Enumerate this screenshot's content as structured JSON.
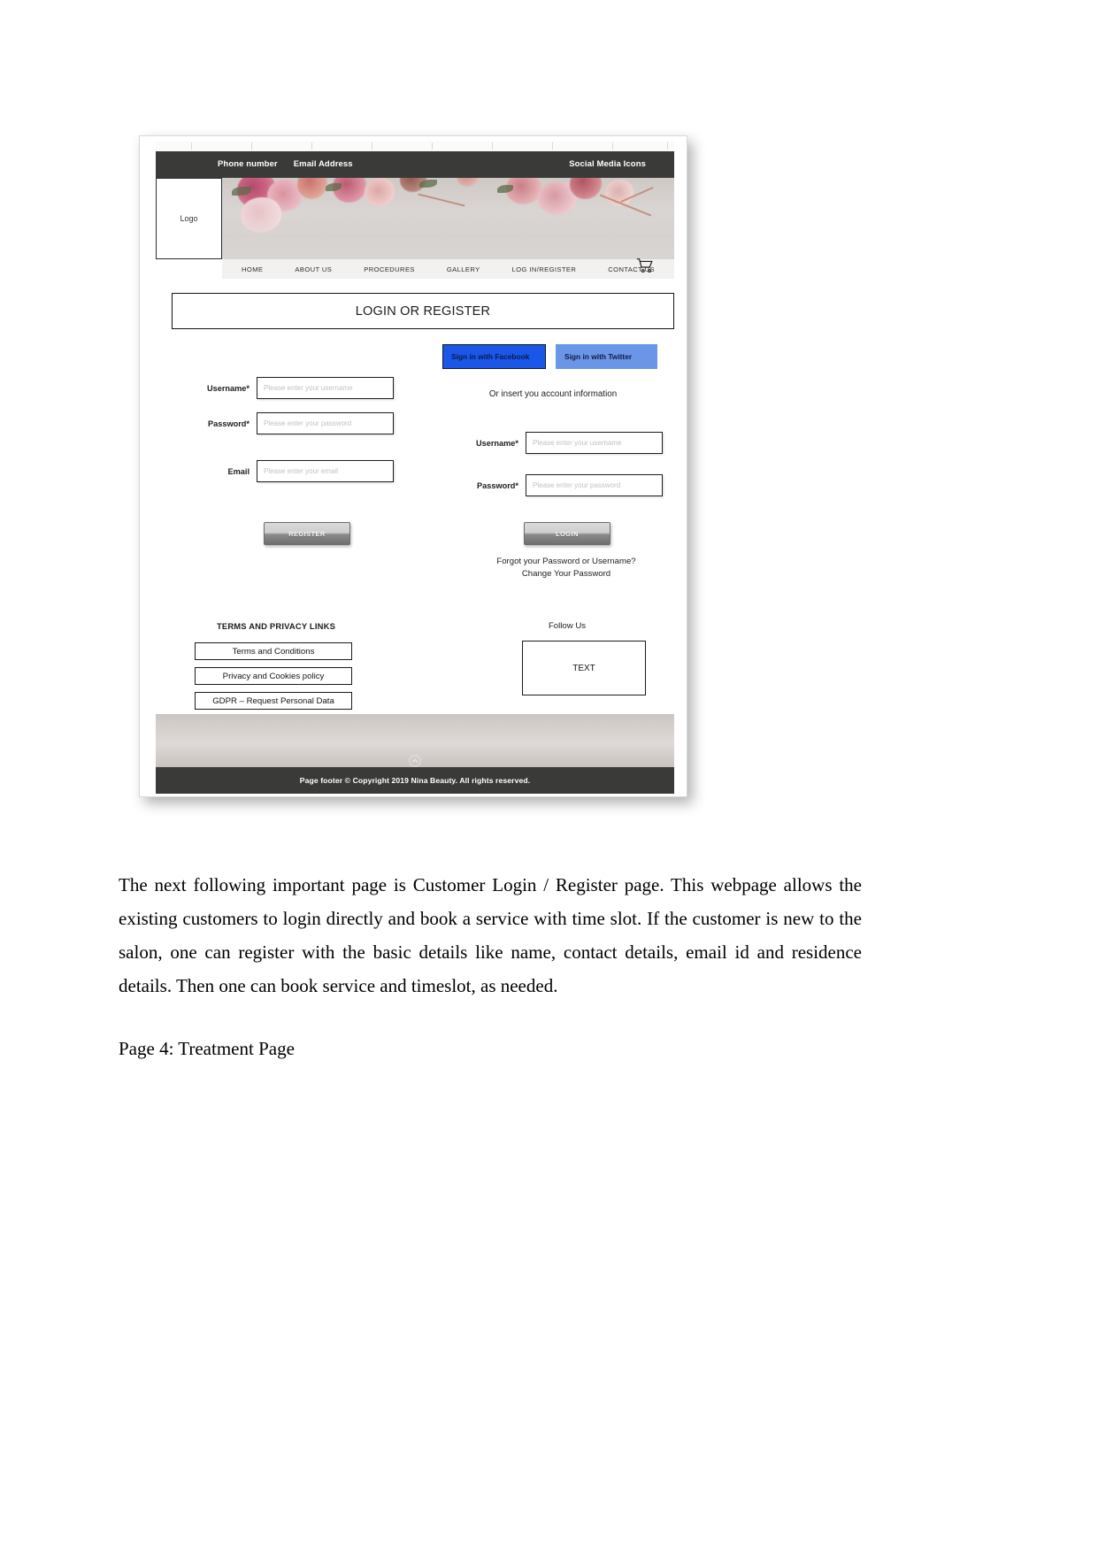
{
  "document": {
    "paragraph": "The next following important page is Customer Login / Register page. This webpage allows the existing customers to login directly and book a service with time slot. If the customer is new to the salon, one can register with the basic details like name, contact details, email id and residence details. Then one can book service and timeslot, as needed.",
    "subheading": "Page 4: Treatment Page"
  },
  "mockup": {
    "topbar": {
      "phone_label": "Phone number",
      "email_label": "Email Address",
      "social_label": "Social Media Icons"
    },
    "logo": "Logo",
    "nav": [
      "HOME",
      "ABOUT US",
      "PROCEDURES",
      "GALLERY",
      "LOG IN/REGISTER",
      "CONTACT US"
    ],
    "cart_icon": "cart-icon",
    "page_title": "LOGIN OR REGISTER",
    "register_form": {
      "username_label": "Username*",
      "username_placeholder": "Please enter your username",
      "password_label": "Password*",
      "password_placeholder": "Please enter your password",
      "email_label": "Email",
      "email_placeholder": "Please enter your email",
      "submit_label": "REGISTER"
    },
    "login_panel": {
      "facebook_label": "Sign in with Facebook",
      "twitter_label": "Sign in with Twitter",
      "divider_text": "Or insert you account information",
      "username_label": "Username*",
      "username_placeholder": "Please enter your username",
      "password_label": "Password*",
      "password_placeholder": "Please enter your password",
      "submit_label": "LOGIN",
      "forgot_line1": "Forgot your Password or Username?",
      "forgot_line2": "Change Your Password"
    },
    "terms": {
      "heading": "TERMS AND PRIVACY LINKS",
      "links": [
        "Terms and Conditions",
        "Privacy and Cookies policy",
        "GDPR – Request Personal Data"
      ]
    },
    "follow": {
      "heading": "Follow Us",
      "box_text": "TEXT"
    },
    "footer": "Page footer  © Copyright 2019 Nina  Beauty. All rights reserved.",
    "colors": {
      "bar_dark": "#3a3a38",
      "facebook_blue": "#1a56e8",
      "twitter_blue": "#6b96e8"
    }
  }
}
